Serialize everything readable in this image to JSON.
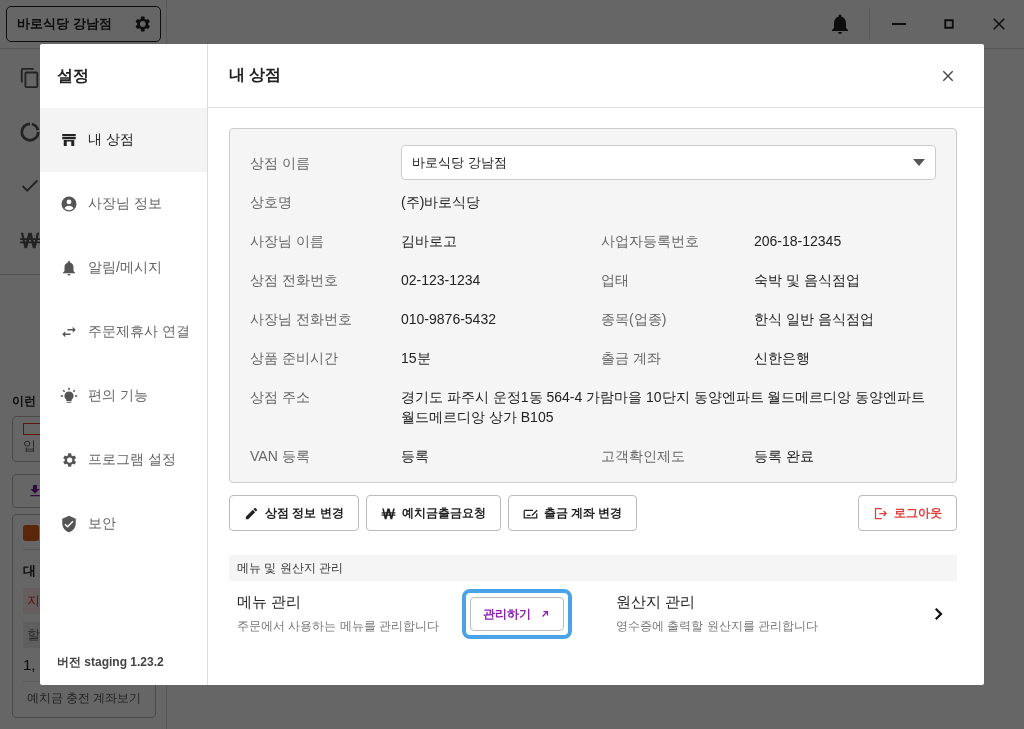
{
  "app": {
    "store_button": "바로식당 강남점",
    "promo_label": "이런",
    "partner_card": "입",
    "wallet_card": {
      "title": "대",
      "alert": "지",
      "row": "할",
      "amount": "1,",
      "button": "예치금 충전 계좌보기"
    }
  },
  "modal": {
    "sidebar_title": "설정",
    "nav": [
      {
        "label": "내 상점",
        "selected": true
      },
      {
        "label": "사장님 정보",
        "selected": false
      },
      {
        "label": "알림/메시지",
        "selected": false
      },
      {
        "label": "주문제휴사 연결",
        "selected": false
      },
      {
        "label": "편의 기능",
        "selected": false
      },
      {
        "label": "프로그램 설정",
        "selected": false
      },
      {
        "label": "보안",
        "selected": false
      }
    ],
    "version": "버전 staging 1.23.2",
    "title": "내 상점",
    "store_select": {
      "label": "상점 이름",
      "value": "바로식당 강남점"
    },
    "info_rows": [
      [
        {
          "label": "상호명",
          "value": "(주)바로식당"
        }
      ],
      [
        {
          "label": "사장님 이름",
          "value": "김바로고"
        },
        {
          "label": "사업자등록번호",
          "value": "206-18-12345"
        }
      ],
      [
        {
          "label": "상점 전화번호",
          "value": "02-123-1234"
        },
        {
          "label": "업태",
          "value": "숙박 및 음식점업"
        }
      ],
      [
        {
          "label": "사장님 전화번호",
          "value": "010-9876-5432"
        },
        {
          "label": "종목(업종)",
          "value": "한식 일반 음식점업"
        }
      ],
      [
        {
          "label": "상품 준비시간",
          "value": "15분"
        },
        {
          "label": "출금 계좌",
          "value": "신한은행"
        }
      ],
      [
        {
          "label": "상점 주소",
          "value": "경기도 파주시 운정1동 564-4 가람마을 10단지 동양엔파트 월드메르디앙 동양엔파트 월드메르디앙 상가 B105"
        }
      ],
      [
        {
          "label": "VAN 등록",
          "value": "등록"
        },
        {
          "label": "고객확인제도",
          "value": "등록 완료"
        }
      ]
    ],
    "actions": [
      {
        "label": "상점 정보 변경"
      },
      {
        "label": "예치금출금요청"
      },
      {
        "label": "출금 계좌 변경"
      }
    ],
    "logout": {
      "label": "로그아웃"
    },
    "section_title": "메뉴 및 원산지 관리",
    "menu": {
      "title": "메뉴 관리",
      "desc": "주문에서 사용하는 메뉴를 관리합니다",
      "button": "관리하기",
      "highlighted": true
    },
    "origin": {
      "title": "원산지 관리",
      "desc": "영수증에 출력할 원산지를 관리합니다"
    }
  }
}
